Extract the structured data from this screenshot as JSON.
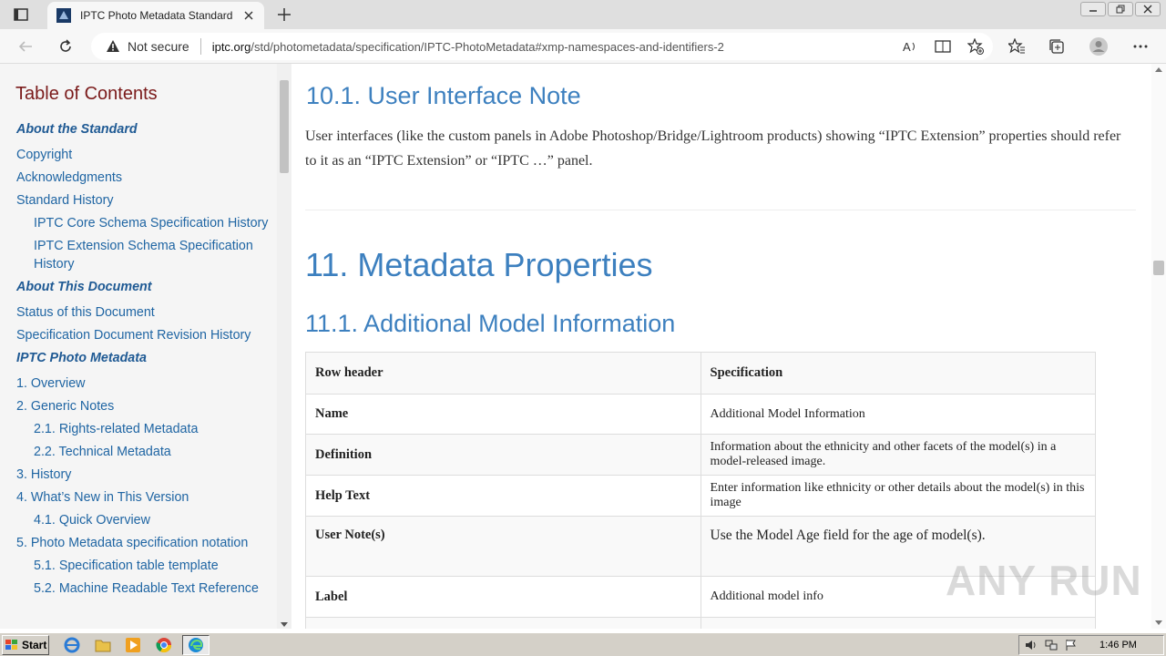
{
  "browser": {
    "tab_title": "IPTC Photo Metadata Standard",
    "security_label": "Not secure",
    "url_host": "iptc.org",
    "url_path": "/std/photometadata/specification/IPTC-PhotoMetadata#xmp-namespaces-and-identifiers-2"
  },
  "sidebar": {
    "title": "Table of Contents",
    "items": [
      {
        "label": "About the Standard",
        "level": "sec"
      },
      {
        "label": "Copyright",
        "level": "l1"
      },
      {
        "label": "Acknowledgments",
        "level": "l1"
      },
      {
        "label": "Standard History",
        "level": "l1"
      },
      {
        "label": "IPTC Core Schema Specification History",
        "level": "l2"
      },
      {
        "label": "IPTC Extension Schema Specification History",
        "level": "l2"
      },
      {
        "label": "About This Document",
        "level": "sec"
      },
      {
        "label": "Status of this Document",
        "level": "l1"
      },
      {
        "label": "Specification Document Revision History",
        "level": "l1"
      },
      {
        "label": "IPTC Photo Metadata",
        "level": "sec"
      },
      {
        "label": "1. Overview",
        "level": "l1"
      },
      {
        "label": "2. Generic Notes",
        "level": "l1"
      },
      {
        "label": "2.1. Rights-related Metadata",
        "level": "l2"
      },
      {
        "label": "2.2. Technical Metadata",
        "level": "l2"
      },
      {
        "label": "3. History",
        "level": "l1"
      },
      {
        "label": "4. What’s New in This Version",
        "level": "l1"
      },
      {
        "label": "4.1. Quick Overview",
        "level": "l2"
      },
      {
        "label": "5. Photo Metadata specification notation",
        "level": "l1"
      },
      {
        "label": "5.1. Specification table template",
        "level": "l2"
      },
      {
        "label": "5.2. Machine Readable Text Reference",
        "level": "l2"
      }
    ]
  },
  "main": {
    "heading_ui_note": "10.1. User Interface Note",
    "ui_note_text": "User interfaces (like the custom panels in Adobe Photoshop/Bridge/Lightroom products) showing “IPTC Extension” properties should refer to it as an “IPTC Extension” or “IPTC …” panel.",
    "heading_metadata": "11. Metadata Properties",
    "heading_additional": "11.1. Additional Model Information",
    "table": {
      "header": [
        "Row header",
        "Specification"
      ],
      "rows": [
        [
          "Name",
          "Additional Model Information"
        ],
        [
          "Definition",
          "Information about the ethnicity and other facets of the model(s) in a model-released image."
        ],
        [
          "Help Text",
          "Enter information like ethnicity or other details about the model(s) in this image"
        ],
        [
          "User Note(s)",
          "Use the Model Age field for the age of model(s)."
        ],
        [
          "Label",
          "Additional model info"
        ],
        [
          "",
          ""
        ]
      ]
    }
  },
  "watermark": "ANY RUN",
  "taskbar": {
    "start_label": "Start",
    "clock": "1:46 PM"
  }
}
